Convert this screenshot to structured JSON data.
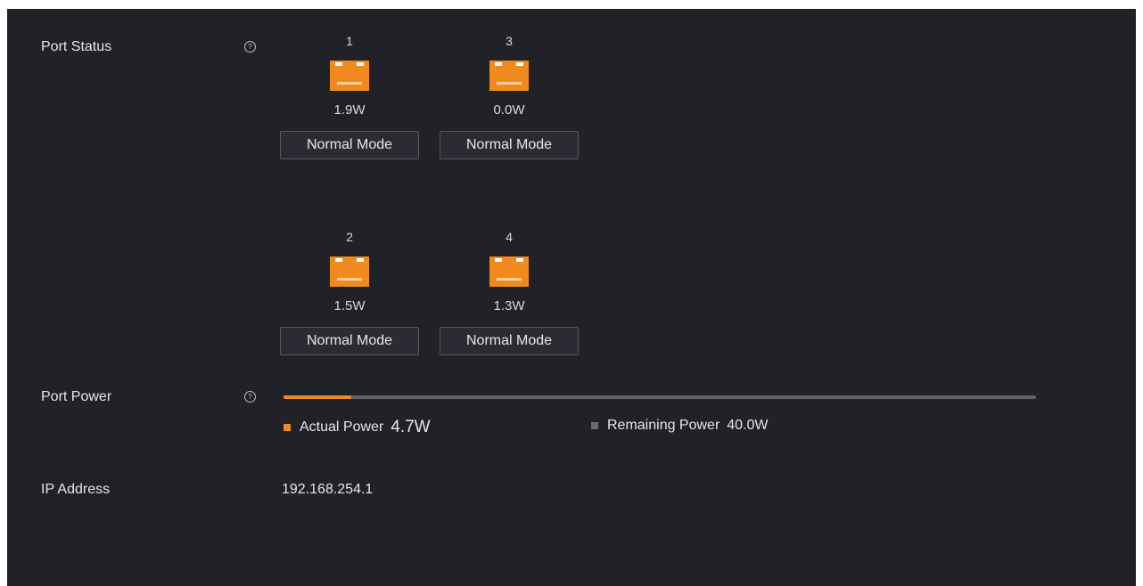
{
  "port_status": {
    "label": "Port Status",
    "help_icon": "question-circle-icon",
    "ports": [
      {
        "number": "1",
        "power": "1.9W",
        "mode": "Normal Mode"
      },
      {
        "number": "3",
        "power": "0.0W",
        "mode": "Normal Mode"
      },
      {
        "number": "2",
        "power": "1.5W",
        "mode": "Normal Mode"
      },
      {
        "number": "4",
        "power": "1.3W",
        "mode": "Normal Mode"
      }
    ]
  },
  "port_power": {
    "label": "Port Power",
    "help_icon": "question-circle-icon",
    "actual_label": "Actual Power",
    "actual_value": "4.7W",
    "remaining_label": "Remaining Power",
    "remaining_value": "40.0W",
    "used_fraction": 0.09,
    "actual_color": "#f08a1c",
    "remaining_color": "#6a6b72"
  },
  "ip_address": {
    "label": "IP Address",
    "value": "192.168.254.1"
  },
  "colors": {
    "background": "#212228",
    "port_icon": "#f08a1c",
    "button_bg": "#2b2c33"
  }
}
